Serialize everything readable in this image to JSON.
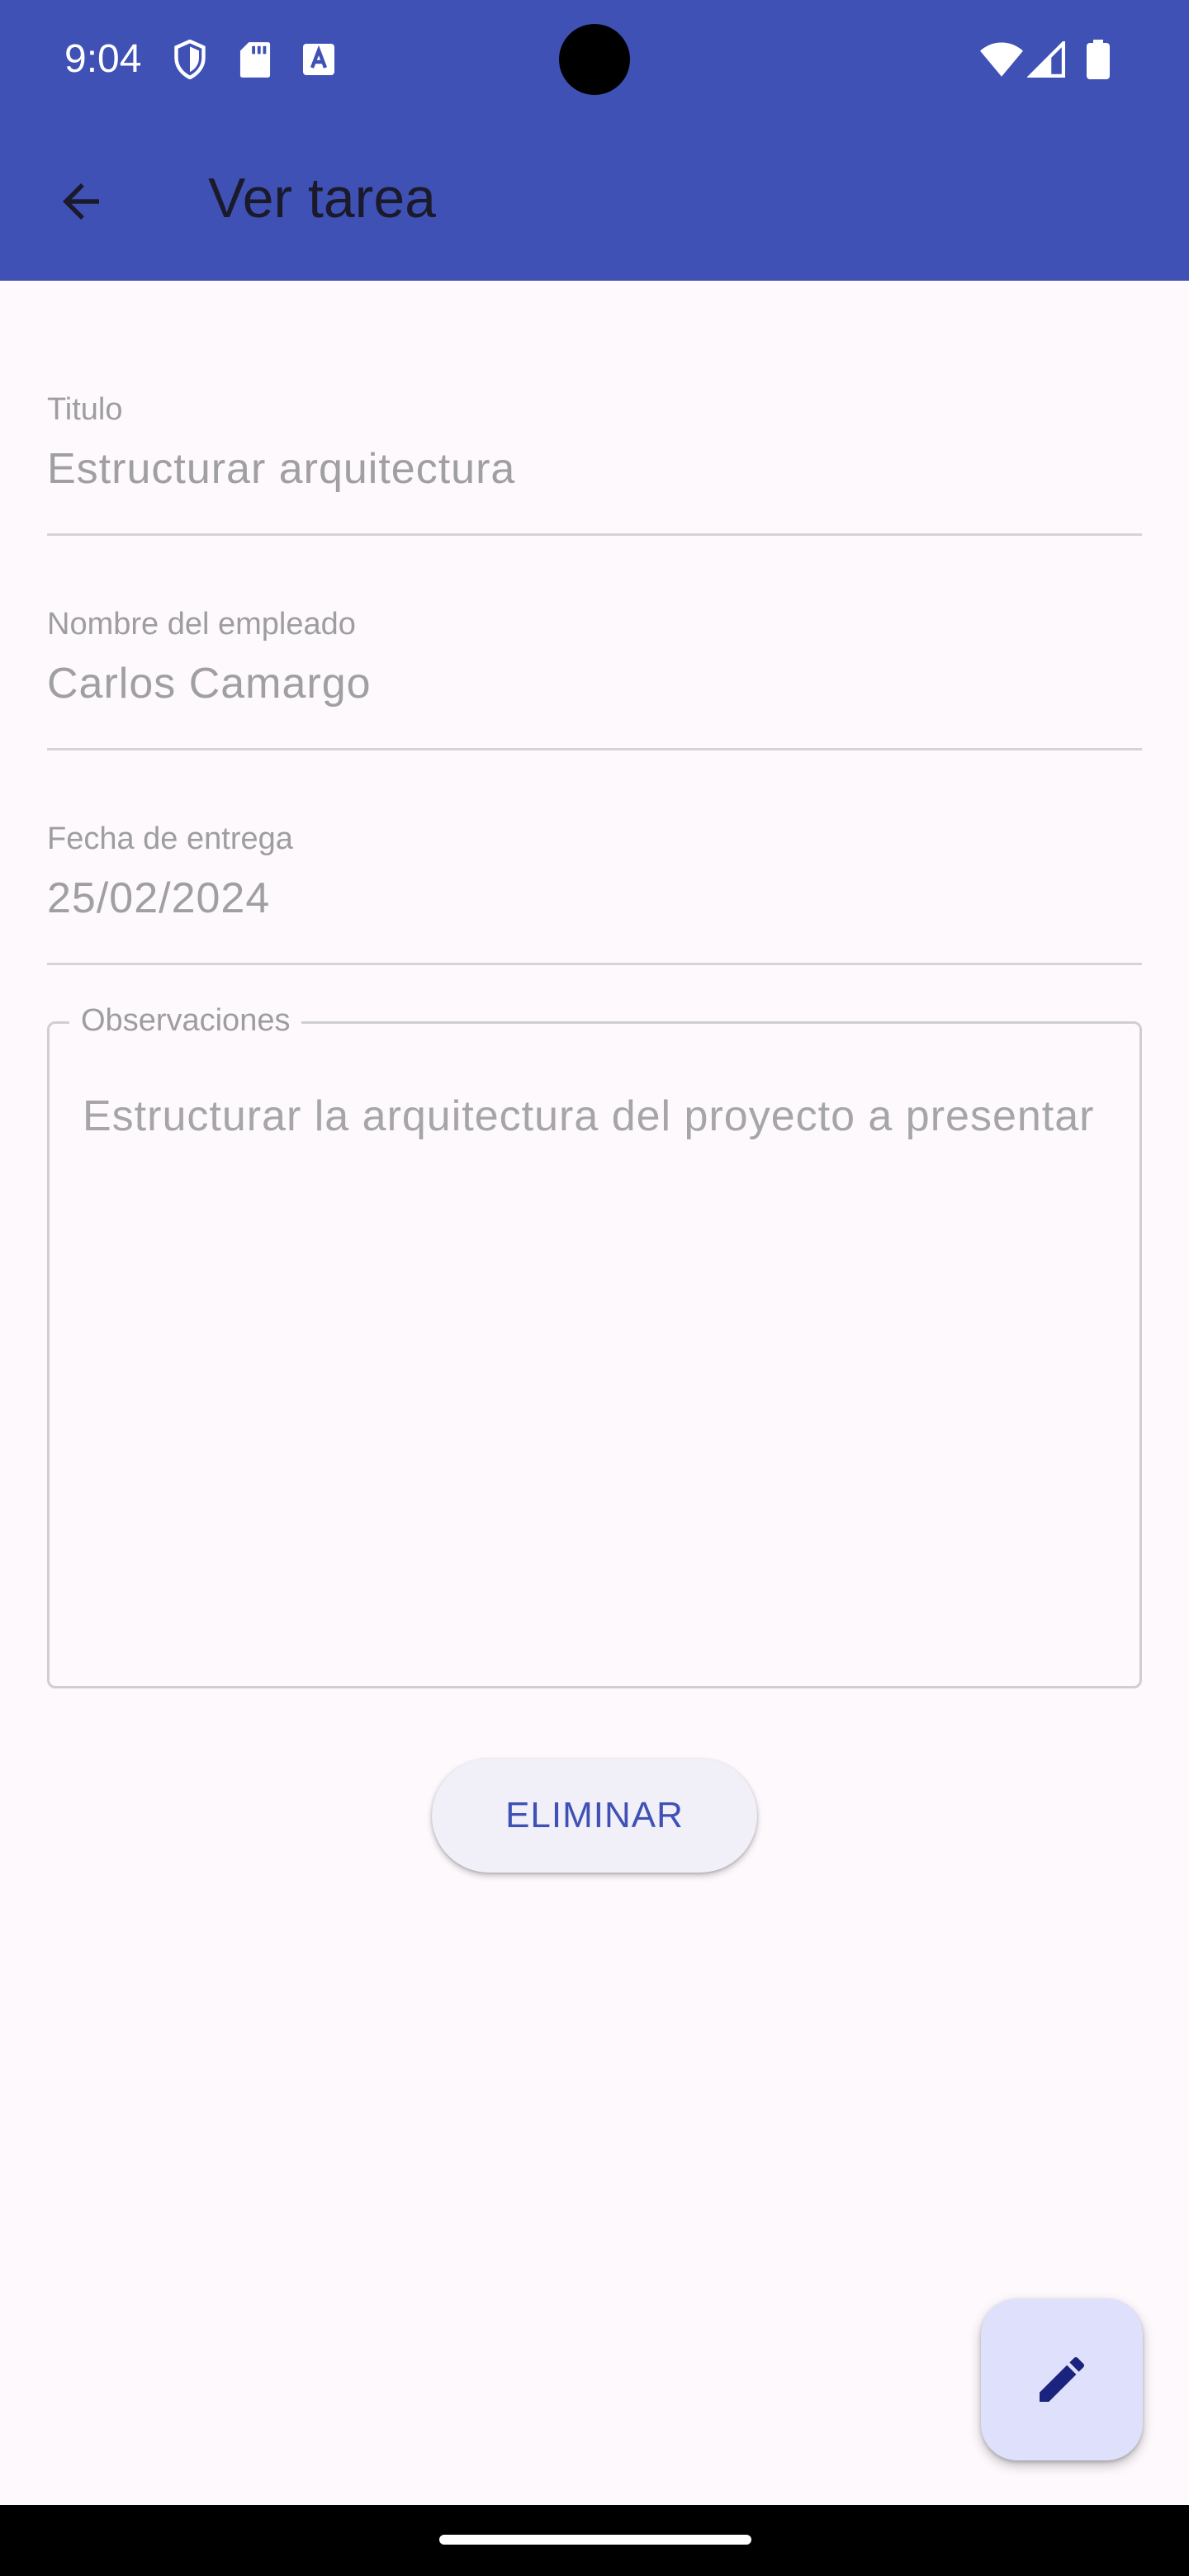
{
  "status_bar": {
    "time": "9:04",
    "left_icons": [
      "shield-icon",
      "sd-card-icon",
      "text-a-icon"
    ],
    "right_icons": [
      "wifi-icon",
      "cell-signal-icon",
      "battery-icon"
    ]
  },
  "app_bar": {
    "back_icon": "arrow-back-icon",
    "title": "Ver tarea",
    "background": "#3f51b5"
  },
  "form": {
    "titulo": {
      "label": "Titulo",
      "value": "Estructurar arquitectura"
    },
    "empleado": {
      "label": "Nombre del empleado",
      "value": "Carlos Camargo"
    },
    "fecha": {
      "label": "Fecha de entrega",
      "value": "25/02/2024"
    },
    "observaciones": {
      "label": "Observaciones",
      "value": "Estructurar la arquitectura del proyecto a presentar"
    }
  },
  "actions": {
    "delete_label": "ELIMINAR",
    "fab_icon": "edit-pencil-icon"
  }
}
